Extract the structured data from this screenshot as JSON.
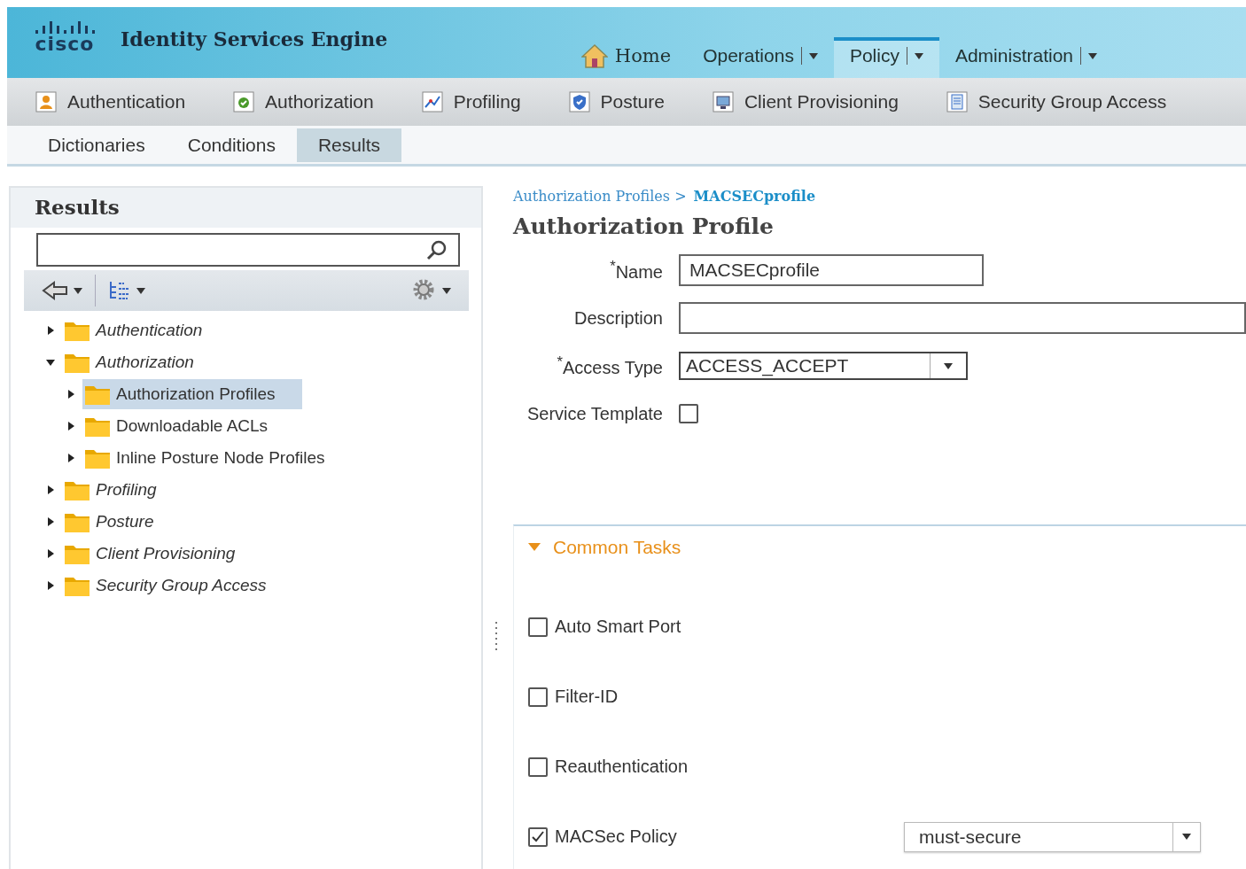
{
  "header": {
    "logo": "cisco",
    "product": "Identity Services Engine",
    "menu": [
      {
        "label": "Home",
        "kind": "home",
        "selected": false
      },
      {
        "label": "Operations",
        "kind": "dropdown",
        "selected": false
      },
      {
        "label": "Policy",
        "kind": "dropdown",
        "selected": true
      },
      {
        "label": "Administration",
        "kind": "dropdown",
        "selected": false
      }
    ]
  },
  "modules": [
    {
      "label": "Authentication",
      "kind": "user"
    },
    {
      "label": "Authorization",
      "kind": "badge"
    },
    {
      "label": "Profiling",
      "kind": "chart"
    },
    {
      "label": "Posture",
      "kind": "shield"
    },
    {
      "label": "Client Provisioning",
      "kind": "monitor"
    },
    {
      "label": "Security Group Access",
      "kind": "document"
    }
  ],
  "subtabs": [
    {
      "label": "Dictionaries",
      "selected": false
    },
    {
      "label": "Conditions",
      "selected": false
    },
    {
      "label": "Results",
      "selected": true
    }
  ],
  "results_panel": {
    "title": "Results",
    "tree": [
      {
        "label": "Authentication",
        "expanded": false,
        "selected": false
      },
      {
        "label": "Authorization",
        "expanded": true,
        "selected": false,
        "children": [
          {
            "label": "Authorization Profiles",
            "expanded": false,
            "selected": true
          },
          {
            "label": "Downloadable ACLs",
            "expanded": false,
            "selected": false
          },
          {
            "label": "Inline Posture Node Profiles",
            "expanded": false,
            "selected": false
          }
        ]
      },
      {
        "label": "Profiling",
        "expanded": false,
        "selected": false
      },
      {
        "label": "Posture",
        "expanded": false,
        "selected": false
      },
      {
        "label": "Client Provisioning",
        "expanded": false,
        "selected": false
      },
      {
        "label": "Security Group Access",
        "expanded": false,
        "selected": false
      }
    ]
  },
  "form": {
    "breadcrumb": {
      "parent": "Authorization Profiles >",
      "current": "MACSECprofile"
    },
    "title": "Authorization Profile",
    "fields": [
      {
        "label": "Name",
        "required_mark": "*",
        "kind": "text",
        "value": "MACSECprofile"
      },
      {
        "label": "Description",
        "kind": "wide"
      },
      {
        "label": "Access Type",
        "required_mark": "*",
        "kind": "select",
        "value": "ACCESS_ACCEPT"
      },
      {
        "label": "Service Template",
        "kind": "checkbox",
        "checked": false
      }
    ],
    "common_tasks": {
      "title": "Common Tasks",
      "expanded": true,
      "items": [
        {
          "label": "Auto Smart Port",
          "checked": false
        },
        {
          "label": "Filter-ID",
          "checked": false
        },
        {
          "label": "Reauthentication",
          "checked": false
        },
        {
          "label": "MACSec Policy",
          "checked": true,
          "value": "must-secure"
        }
      ]
    }
  }
}
